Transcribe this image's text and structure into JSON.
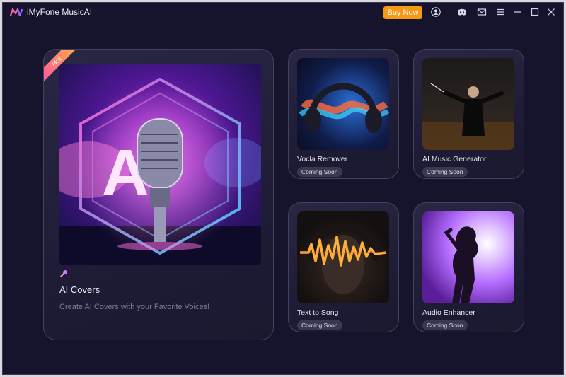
{
  "app": {
    "title": "iMyFone MusicAI",
    "buy_label": "Buy Now",
    "accent": "#f59a12",
    "background": "#16142c"
  },
  "titlebar_icons": [
    "user-icon",
    "discord-icon",
    "mail-icon",
    "menu-icon",
    "minimize-icon",
    "maximize-icon",
    "close-icon"
  ],
  "featured": {
    "badge": "Hot",
    "art_text": "AI",
    "title": "AI Covers",
    "subtitle": "Create AI Covers with your Favorite Voices!"
  },
  "tools": [
    {
      "title": "Vocla Remover",
      "status": "Coming Soon"
    },
    {
      "title": "AI Music Generator",
      "status": "Coming Soon"
    },
    {
      "title": "Text to Song",
      "status": "Coming Soon"
    },
    {
      "title": "Audio Enhancer",
      "status": "Coming Soon"
    }
  ]
}
